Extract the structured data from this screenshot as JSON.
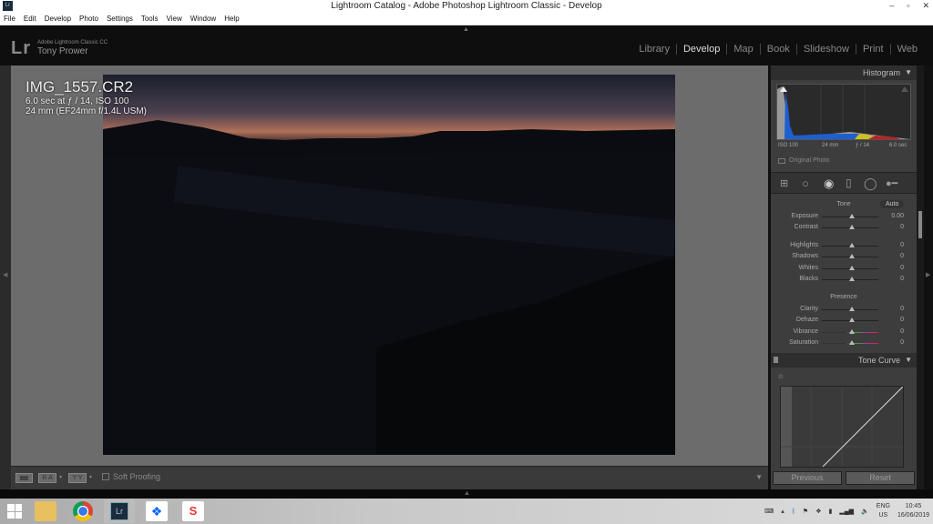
{
  "window": {
    "title": "Lightroom Catalog - Adobe Photoshop Lightroom Classic - Develop",
    "app_icon": "Lr",
    "controls": [
      "minimize",
      "maximize",
      "close"
    ]
  },
  "menu": [
    "File",
    "Edit",
    "Develop",
    "Photo",
    "Settings",
    "Tools",
    "View",
    "Window",
    "Help"
  ],
  "identity": {
    "logo": "Lr",
    "product": "Adobe Lightroom Classic CC",
    "user": "Tony Prower"
  },
  "modules": [
    "Library",
    "Develop",
    "Map",
    "Book",
    "Slideshow",
    "Print",
    "Web"
  ],
  "active_module": "Develop",
  "photo_info": {
    "filename": "IMG_1557.CR2",
    "exposure": "6.0 sec at ƒ / 14, ISO 100",
    "lens": "24 mm (EF24mm f/1.4L USM)"
  },
  "toolbar": {
    "view_a": "",
    "view_b": "R A",
    "view_c": "Y Y",
    "soft_proofing": "Soft Proofing"
  },
  "histogram": {
    "title": "Histogram",
    "iso": "ISO 100",
    "focal": "24 mm",
    "aperture": "ƒ / 14",
    "shutter": "6.0 sec",
    "original_photo": "Original Photo"
  },
  "basic": {
    "tone_label": "Tone",
    "auto": "Auto",
    "tone": [
      {
        "label": "Exposure",
        "value": "0.00"
      },
      {
        "label": "Contrast",
        "value": "0"
      }
    ],
    "tone2": [
      {
        "label": "Highlights",
        "value": "0"
      },
      {
        "label": "Shadows",
        "value": "0"
      },
      {
        "label": "Whites",
        "value": "0"
      },
      {
        "label": "Blacks",
        "value": "0"
      }
    ],
    "presence_label": "Presence",
    "presence": [
      {
        "label": "Clarity",
        "value": "0"
      },
      {
        "label": "Dehaze",
        "value": "0"
      },
      {
        "label": "Vibrance",
        "value": "0"
      },
      {
        "label": "Saturation",
        "value": "0"
      }
    ]
  },
  "tone_curve": {
    "title": "Tone Curve"
  },
  "buttons": {
    "previous": "Previous",
    "reset": "Reset"
  },
  "tray": {
    "lang1": "ENG",
    "lang2": "US",
    "time": "10:45",
    "date": "16/06/2019"
  }
}
